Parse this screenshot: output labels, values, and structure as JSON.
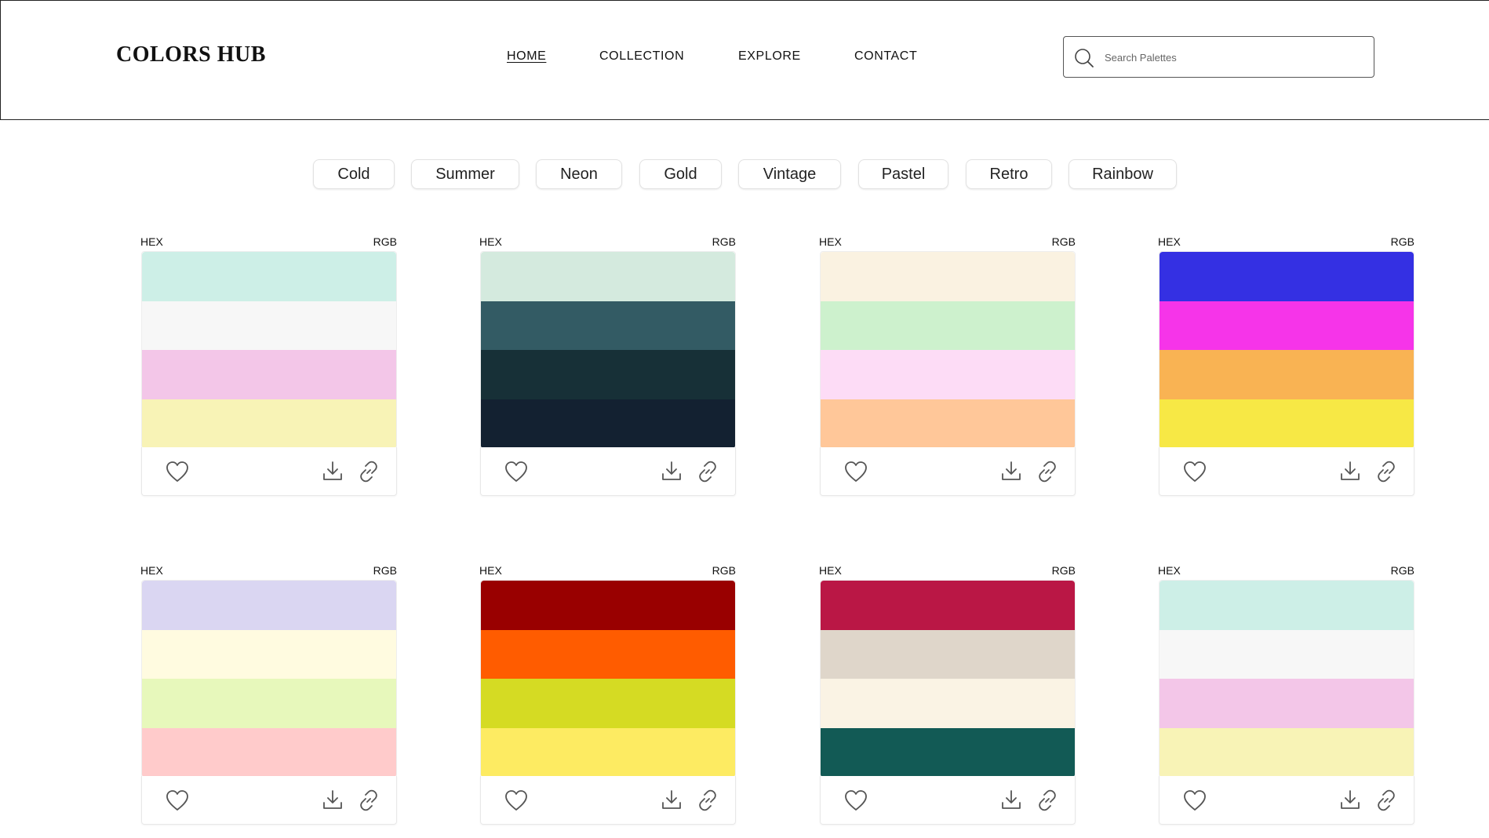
{
  "header": {
    "logo": "COLORS HUB",
    "nav": [
      "HOME",
      "COLLECTION",
      "EXPLORE",
      "CONTACT"
    ],
    "active_nav": "HOME",
    "search_placeholder": "Search Palettes"
  },
  "tags": [
    "Cold",
    "Summer",
    "Neon",
    "Gold",
    "Vintage",
    "Pastel",
    "Retro",
    "Rainbow"
  ],
  "palette_labels": {
    "left": "HEX",
    "right": "RGB"
  },
  "palettes": [
    {
      "colors": [
        "#CDEFE7",
        "#F7F7F7",
        "#F3C6E8",
        "#F8F3B6"
      ]
    },
    {
      "colors": [
        "#D4EADE",
        "#335B64",
        "#173037",
        "#132131"
      ]
    },
    {
      "colors": [
        "#FAF2E1",
        "#CDF1CD",
        "#FDDCF6",
        "#FFC799"
      ]
    },
    {
      "colors": [
        "#3430E3",
        "#F634E9",
        "#F9B353",
        "#F7E845"
      ]
    },
    {
      "colors": [
        "#DAD6F2",
        "#FFFBE0",
        "#E7F8BB",
        "#FFCBCB"
      ]
    },
    {
      "colors": [
        "#990000",
        "#FF5C00",
        "#D5DB23",
        "#FDEB62"
      ]
    },
    {
      "colors": [
        "#BA1745",
        "#DFD6CA",
        "#FAF3E4",
        "#125A55"
      ]
    },
    {
      "colors": [
        "#CDEFE7",
        "#F7F7F7",
        "#F3C6E8",
        "#F8F3B6"
      ]
    }
  ]
}
